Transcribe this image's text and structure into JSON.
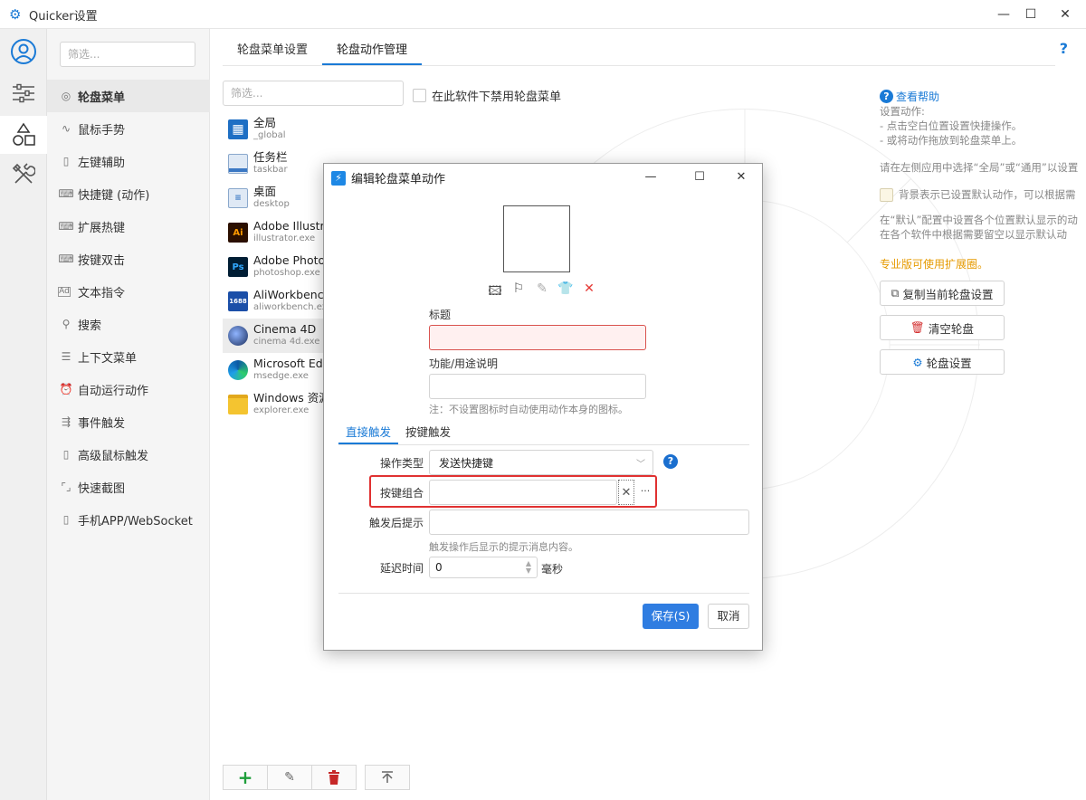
{
  "window": {
    "title": "Quicker设置",
    "minimize": "—",
    "maximize": "☐",
    "close": "✕"
  },
  "sidebar": {
    "filter_placeholder": "筛选...",
    "items": [
      {
        "label": "轮盘菜单",
        "icon": "wheel-icon"
      },
      {
        "label": "鼠标手势",
        "icon": "gesture-icon"
      },
      {
        "label": "左键辅助",
        "icon": "mouse-icon"
      },
      {
        "label": "快捷键 (动作)",
        "icon": "keyboard-icon"
      },
      {
        "label": "扩展热键",
        "icon": "keyboard-icon"
      },
      {
        "label": "按键双击",
        "icon": "keyboard-icon"
      },
      {
        "label": "文本指令",
        "icon": "text-ad-icon"
      },
      {
        "label": "搜索",
        "icon": "search-icon"
      },
      {
        "label": "上下文菜单",
        "icon": "menu-icon"
      },
      {
        "label": "自动运行动作",
        "icon": "alarm-icon"
      },
      {
        "label": "事件触发",
        "icon": "event-icon"
      },
      {
        "label": "高级鼠标触发",
        "icon": "mouse-icon"
      },
      {
        "label": "快速截图",
        "icon": "screenshot-icon"
      },
      {
        "label": "手机APP/WebSocket",
        "icon": "phone-icon"
      }
    ]
  },
  "main": {
    "tabs": [
      "轮盘菜单设置",
      "轮盘动作管理"
    ],
    "help": "?",
    "app_filter_placeholder": "筛选...",
    "disable_label": "在此软件下禁用轮盘菜单",
    "apps": [
      {
        "name": "全局",
        "sub": "_global",
        "icon": "grid-icon"
      },
      {
        "name": "任务栏",
        "sub": "taskbar",
        "icon": "taskbar-icon"
      },
      {
        "name": "桌面",
        "sub": "desktop",
        "icon": "desktop-icon"
      },
      {
        "name": "Adobe Illustrator",
        "sub": "illustrator.exe",
        "icon": "illustrator-icon",
        "badge": "Ai"
      },
      {
        "name": "Adobe Photoshop",
        "sub": "photoshop.exe",
        "icon": "photoshop-icon",
        "badge": "Ps"
      },
      {
        "name": "AliWorkbench",
        "sub": "aliworkbench.exe",
        "icon": "aliworkbench-icon",
        "badge": "1688"
      },
      {
        "name": "Cinema 4D",
        "sub": "cinema 4d.exe",
        "icon": "cinema4d-icon"
      },
      {
        "name": "Microsoft Edge",
        "sub": "msedge.exe",
        "icon": "edge-icon"
      },
      {
        "name": "Windows 资源管理器",
        "sub": "explorer.exe",
        "icon": "folder-icon"
      }
    ],
    "bottom_buttons": [
      "add-icon",
      "edit-icon",
      "delete-icon",
      "move-top-icon"
    ]
  },
  "right_panel": {
    "help_link": "查看帮助",
    "lines": [
      "设置动作:",
      "- 点击空白位置设置快捷操作。",
      "- 或将动作拖放到轮盘菜单上。"
    ],
    "para1": "请在左侧应用中选择“全局”或“通用”以设置",
    "check_label": "背景表示已设置默认动作，可以根据需",
    "para2_1": "在“默认”配置中设置各个位置默认显示的动",
    "para2_2": "在各个软件中根据需要留空以显示默认动",
    "pro_note": "专业版可使用扩展圈。",
    "buttons": [
      "复制当前轮盘设置",
      "清空轮盘",
      "轮盘设置"
    ]
  },
  "dialog": {
    "title": "编辑轮盘菜单动作",
    "tools": [
      "image-icon",
      "flag-icon",
      "pen-icon",
      "shirt-icon",
      "red-x-icon"
    ],
    "title_label": "标题",
    "title_value": "",
    "desc_label": "功能/用途说明",
    "desc_value": "",
    "note": "注：不设置图标时自动使用动作本身的图标。",
    "tabs": [
      "直接触发",
      "按键触发"
    ],
    "op_type_label": "操作类型",
    "op_type_value": "发送快捷键",
    "key_combo_label": "按键组合",
    "key_combo_value": "",
    "tip_label": "触发后提示",
    "tip_value": "",
    "tip_hint": "触发操作后显示的提示消息内容。",
    "delay_label": "延迟时间",
    "delay_value": "0",
    "delay_unit": "毫秒",
    "save": "保存(S)",
    "cancel": "取消"
  },
  "colors": {
    "accent": "#1a7ad6",
    "error": "#e03131",
    "pro": "#e69a00"
  }
}
